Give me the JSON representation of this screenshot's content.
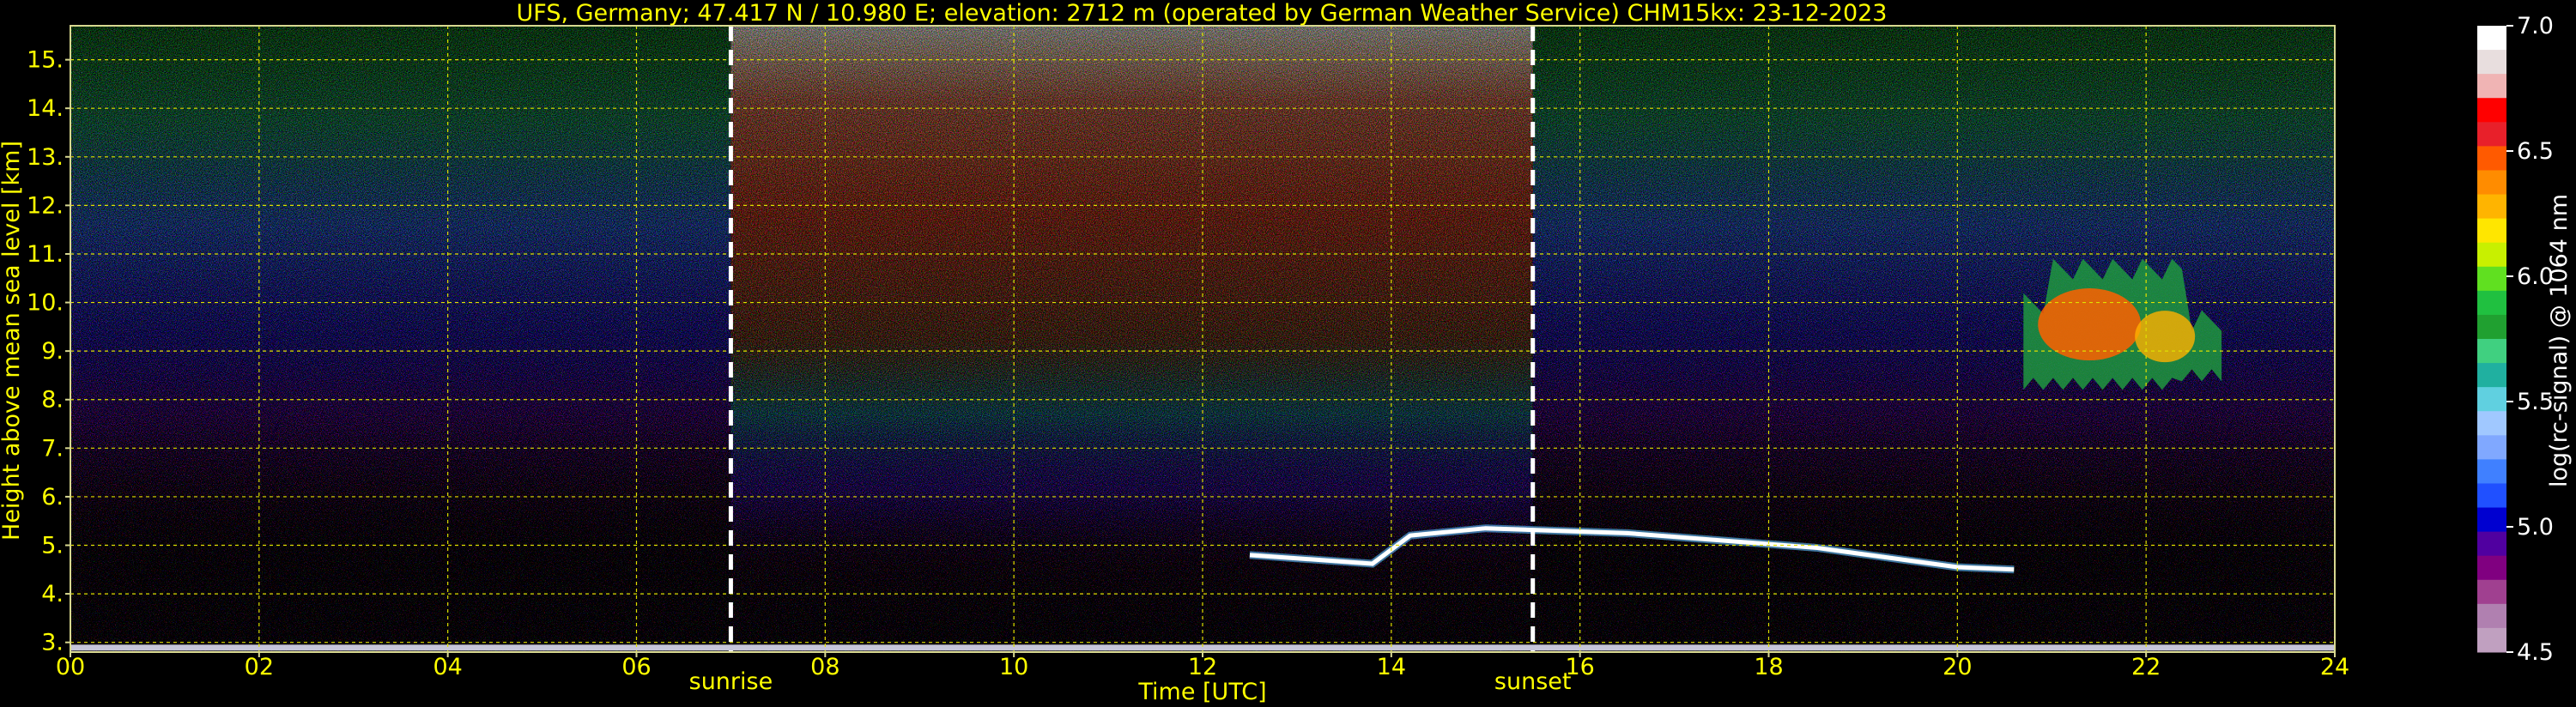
{
  "chart_data": {
    "type": "heatmap",
    "title": "UFS, Germany; 47.417 N / 10.980 E; elevation: 2712 m  (operated by German Weather Service)    CHM15kx: 23-12-2023",
    "xlabel": "Time [UTC]",
    "ylabel": "Height above mean sea level [km]",
    "xlim": [
      0,
      24
    ],
    "ylim": [
      2.8,
      15.7
    ],
    "x_ticks": [
      {
        "value": 0,
        "label": "00"
      },
      {
        "value": 2,
        "label": "02"
      },
      {
        "value": 4,
        "label": "04"
      },
      {
        "value": 6,
        "label": "06"
      },
      {
        "value": 8,
        "label": "08"
      },
      {
        "value": 10,
        "label": "10"
      },
      {
        "value": 12,
        "label": "12"
      },
      {
        "value": 14,
        "label": "14"
      },
      {
        "value": 16,
        "label": "16"
      },
      {
        "value": 18,
        "label": "18"
      },
      {
        "value": 20,
        "label": "20"
      },
      {
        "value": 22,
        "label": "22"
      },
      {
        "value": 24,
        "label": "24"
      }
    ],
    "y_ticks": [
      {
        "value": 3,
        "label": "3."
      },
      {
        "value": 4,
        "label": "4."
      },
      {
        "value": 5,
        "label": "5."
      },
      {
        "value": 6,
        "label": "6."
      },
      {
        "value": 7,
        "label": "7."
      },
      {
        "value": 8,
        "label": "8."
      },
      {
        "value": 9,
        "label": "9."
      },
      {
        "value": 10,
        "label": "10."
      },
      {
        "value": 11,
        "label": "11."
      },
      {
        "value": 12,
        "label": "12."
      },
      {
        "value": 13,
        "label": "13."
      },
      {
        "value": 14,
        "label": "14."
      },
      {
        "value": 15,
        "label": "15."
      }
    ],
    "grid": true,
    "markers": [
      {
        "label": "sunrise",
        "time": 7.0
      },
      {
        "label": "sunset",
        "time": 15.5
      }
    ],
    "colorbar": {
      "label": "log(rc-signal) @ 1064 nm",
      "range": [
        4.5,
        7.0
      ],
      "ticks": [
        {
          "value": 7.0,
          "label": "7.0"
        },
        {
          "value": 6.5,
          "label": "6.5"
        },
        {
          "value": 6.0,
          "label": "6.0"
        },
        {
          "value": 5.5,
          "label": "5.5"
        },
        {
          "value": 5.0,
          "label": "5.0"
        },
        {
          "value": 4.5,
          "label": "4.5"
        }
      ],
      "levels": [
        "#ffffff",
        "#e8dede",
        "#f0b4b4",
        "#ff0000",
        "#e8202a",
        "#ff5a00",
        "#ff8c00",
        "#ffb400",
        "#ffe600",
        "#c8f000",
        "#60e020",
        "#20c040",
        "#20a030",
        "#40d080",
        "#20b0a0",
        "#60d0e0",
        "#a0c8ff",
        "#80a8ff",
        "#4080ff",
        "#2050ff",
        "#0000d0",
        "#5000a0",
        "#800080",
        "#a04090",
        "#b080b0",
        "#c0a0c0"
      ]
    },
    "features": [
      {
        "name": "cloud layer",
        "start": 12.5,
        "end": 20.6,
        "height_start": 4.8,
        "height_peak": 5.35,
        "height_end": 4.5,
        "value": 7.0
      },
      {
        "name": "cirrus",
        "start": 20.7,
        "end": 22.8,
        "height_bottom": 8.2,
        "height_top": 10.9,
        "value": 6.4
      },
      {
        "name": "ground signal",
        "start": 0,
        "end": 24,
        "height": 2.9,
        "value": 6.8
      }
    ]
  }
}
